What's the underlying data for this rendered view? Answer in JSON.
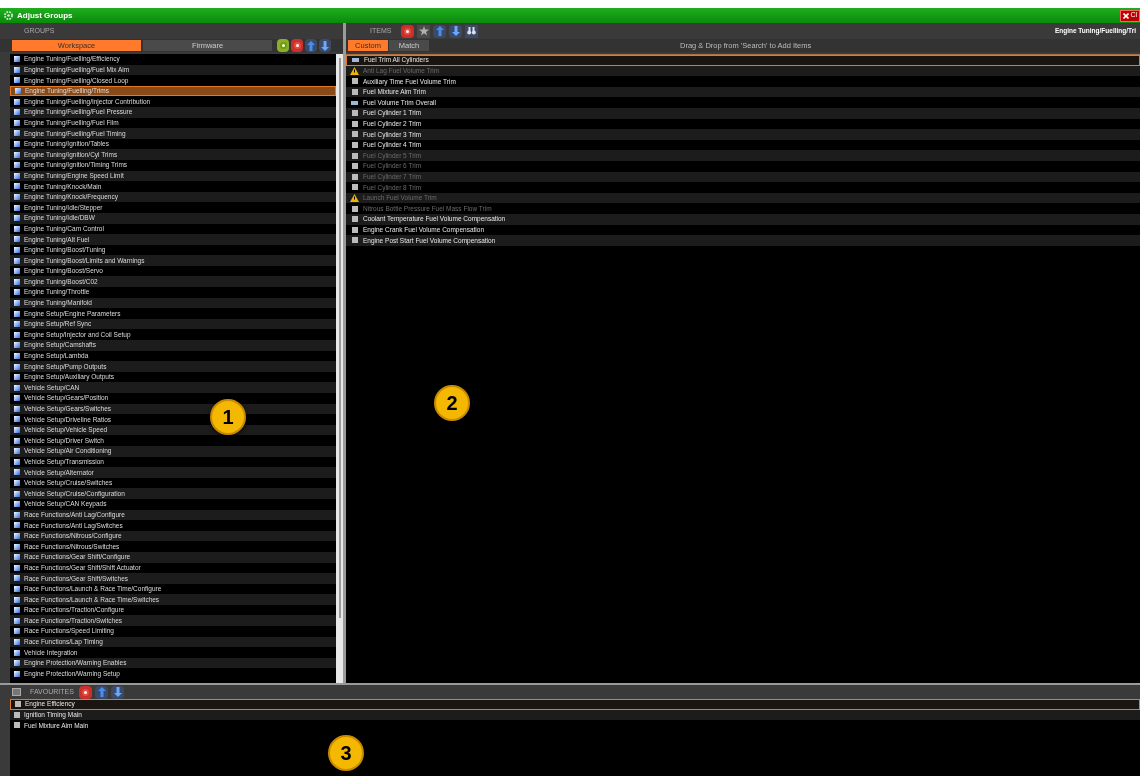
{
  "window": {
    "title": "Adjust Groups",
    "close_label": "Cl"
  },
  "groups": {
    "header": "GROUPS",
    "tabs": [
      {
        "label": "Workspace",
        "selected": true
      },
      {
        "label": "Firmware",
        "selected": false
      }
    ],
    "items": [
      {
        "label": "Engine Tuning/Fuelling/Efficiency",
        "selected": false
      },
      {
        "label": "Engine Tuning/Fuelling/Fuel Mix Aim",
        "selected": false
      },
      {
        "label": "Engine Tuning/Fuelling/Closed Loop",
        "selected": false
      },
      {
        "label": "Engine Tuning/Fuelling/Trims",
        "selected": true
      },
      {
        "label": "Engine Tuning/Fuelling/Injector Contribution",
        "selected": false
      },
      {
        "label": "Engine Tuning/Fuelling/Fuel Pressure",
        "selected": false
      },
      {
        "label": "Engine Tuning/Fuelling/Fuel Film",
        "selected": false
      },
      {
        "label": "Engine Tuning/Fuelling/Fuel Timing",
        "selected": false
      },
      {
        "label": "Engine Tuning/Ignition/Tables",
        "selected": false
      },
      {
        "label": "Engine Tuning/Ignition/Cyl Trims",
        "selected": false
      },
      {
        "label": "Engine Tuning/Ignition/Timing Trims",
        "selected": false
      },
      {
        "label": "Engine Tuning/Engine Speed Limit",
        "selected": false
      },
      {
        "label": "Engine Tuning/Knock/Main",
        "selected": false
      },
      {
        "label": "Engine Tuning/Knock/Frequency",
        "selected": false
      },
      {
        "label": "Engine Tuning/Idle/Stepper",
        "selected": false
      },
      {
        "label": "Engine Tuning/Idle/DBW",
        "selected": false
      },
      {
        "label": "Engine Tuning/Cam Control",
        "selected": false
      },
      {
        "label": "Engine Tuning/Alt Fuel",
        "selected": false
      },
      {
        "label": "Engine Tuning/Boost/Tuning",
        "selected": false
      },
      {
        "label": "Engine Tuning/Boost/Limits and Warnings",
        "selected": false
      },
      {
        "label": "Engine Tuning/Boost/Servo",
        "selected": false
      },
      {
        "label": "Engine Tuning/Boost/C02",
        "selected": false
      },
      {
        "label": "Engine Tuning/Throttle",
        "selected": false
      },
      {
        "label": "Engine Tuning/Manifold",
        "selected": false
      },
      {
        "label": "Engine Setup/Engine Parameters",
        "selected": false
      },
      {
        "label": "Engine Setup/Ref Sync",
        "selected": false
      },
      {
        "label": "Engine Setup/Injector and Coil Setup",
        "selected": false
      },
      {
        "label": "Engine Setup/Camshafts",
        "selected": false
      },
      {
        "label": "Engine Setup/Lambda",
        "selected": false
      },
      {
        "label": "Engine Setup/Pump Outputs",
        "selected": false
      },
      {
        "label": "Engine Setup/Auxiliary Outputs",
        "selected": false
      },
      {
        "label": "Vehicle Setup/CAN",
        "selected": false
      },
      {
        "label": "Vehicle Setup/Gears/Position",
        "selected": false
      },
      {
        "label": "Vehicle Setup/Gears/Switches",
        "selected": false
      },
      {
        "label": "Vehicle Setup/Driveline Ratios",
        "selected": false
      },
      {
        "label": "Vehicle Setup/Vehicle Speed",
        "selected": false
      },
      {
        "label": "Vehicle Setup/Driver Switch",
        "selected": false
      },
      {
        "label": "Vehicle Setup/Air Conditioning",
        "selected": false
      },
      {
        "label": "Vehicle Setup/Transmission",
        "selected": false
      },
      {
        "label": "Vehicle Setup/Alternator",
        "selected": false
      },
      {
        "label": "Vehicle Setup/Cruise/Switches",
        "selected": false
      },
      {
        "label": "Vehicle Setup/Cruise/Configuration",
        "selected": false
      },
      {
        "label": "Vehicle Setup/CAN Keypads",
        "selected": false
      },
      {
        "label": "Race Functions/Anti Lag/Configure",
        "selected": false
      },
      {
        "label": "Race Functions/Anti Lag/Switches",
        "selected": false
      },
      {
        "label": "Race Functions/Nitrous/Configure",
        "selected": false
      },
      {
        "label": "Race Functions/Nitrous/Switches",
        "selected": false
      },
      {
        "label": "Race Functions/Gear Shift/Configure",
        "selected": false
      },
      {
        "label": "Race Functions/Gear Shift/Shift Actuator",
        "selected": false
      },
      {
        "label": "Race Functions/Gear Shift/Switches",
        "selected": false
      },
      {
        "label": "Race Functions/Launch & Race Time/Configure",
        "selected": false
      },
      {
        "label": "Race Functions/Launch & Race Time/Switches",
        "selected": false
      },
      {
        "label": "Race Functions/Traction/Configure",
        "selected": false
      },
      {
        "label": "Race Functions/Traction/Switches",
        "selected": false
      },
      {
        "label": "Race Functions/Speed Limiting",
        "selected": false
      },
      {
        "label": "Race Functions/Lap Timing",
        "selected": false
      },
      {
        "label": "Vehicle Integration",
        "selected": false
      },
      {
        "label": "Engine Protection/Warning Enables",
        "selected": false
      },
      {
        "label": "Engine Protection/Warning Setup",
        "selected": false
      }
    ],
    "callout": "1"
  },
  "items": {
    "header": "ITEMS",
    "breadcrumb": "Engine Tuning/Fuelling/Tri",
    "tabs": [
      {
        "label": "Custom",
        "selected": true
      },
      {
        "label": "Match",
        "selected": false
      }
    ],
    "hint": "Drag & Drop from 'Search' to Add Items",
    "rows": [
      {
        "label": "Fuel Trim All Cylinders",
        "kind": "table",
        "disabled": false,
        "selected": true
      },
      {
        "label": "Anti Lag Fuel Volume Trim",
        "kind": "warning",
        "disabled": true,
        "selected": false
      },
      {
        "label": "Auxiliary Time Fuel Volume Trim",
        "kind": "value",
        "disabled": false,
        "selected": false
      },
      {
        "label": "Fuel Mixture Aim Trim",
        "kind": "value",
        "disabled": false,
        "selected": false
      },
      {
        "label": "Fuel Volume Trim Overall",
        "kind": "table",
        "disabled": false,
        "selected": false
      },
      {
        "label": "Fuel Cylinder 1 Trim",
        "kind": "value",
        "disabled": false,
        "selected": false
      },
      {
        "label": "Fuel Cylinder 2 Trim",
        "kind": "value",
        "disabled": false,
        "selected": false
      },
      {
        "label": "Fuel Cylinder 3 Trim",
        "kind": "value",
        "disabled": false,
        "selected": false
      },
      {
        "label": "Fuel Cylinder 4 Trim",
        "kind": "value",
        "disabled": false,
        "selected": false
      },
      {
        "label": "Fuel Cylinder 5 Trim",
        "kind": "value",
        "disabled": true,
        "selected": false
      },
      {
        "label": "Fuel Cylinder 6 Trim",
        "kind": "value",
        "disabled": true,
        "selected": false
      },
      {
        "label": "Fuel Cylinder 7 Trim",
        "kind": "value",
        "disabled": true,
        "selected": false
      },
      {
        "label": "Fuel Cylinder 8 Trim",
        "kind": "value",
        "disabled": true,
        "selected": false
      },
      {
        "label": "Launch Fuel Volume Trim",
        "kind": "warning",
        "disabled": true,
        "selected": false
      },
      {
        "label": "Nitrous Bottle Pressure Fuel Mass Flow Trim",
        "kind": "value",
        "disabled": true,
        "selected": false
      },
      {
        "label": "Coolant Temperature Fuel Volume Compensation",
        "kind": "value",
        "disabled": false,
        "selected": false
      },
      {
        "label": "Engine Crank Fuel Volume Compensation",
        "kind": "value",
        "disabled": false,
        "selected": false
      },
      {
        "label": "Engine Post Start Fuel Volume Compensation",
        "kind": "value",
        "disabled": false,
        "selected": false
      }
    ],
    "callout": "2"
  },
  "favourites": {
    "header": "FAVOURITES",
    "rows": [
      {
        "label": "Engine Efficiency",
        "selected": true
      },
      {
        "label": "Ignition Timing Main",
        "selected": false
      },
      {
        "label": "Fuel Mixture Aim Main",
        "selected": false
      }
    ],
    "callout": "3"
  }
}
